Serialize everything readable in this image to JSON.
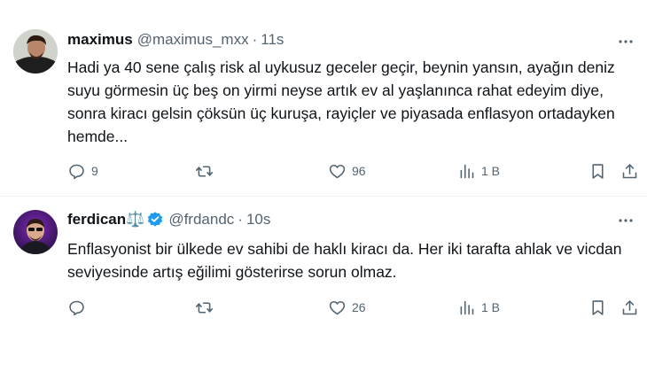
{
  "tweets": [
    {
      "author": "maximus",
      "handle": "@maximus_mxx",
      "separator": "·",
      "time": "11s",
      "text": "Hadi ya 40 sene çalış risk al uykusuz geceler geçir, beynin yansın, ayağın deniz suyu görmesin üç beş on yirmi neyse artık ev al yaşlanınca rahat edeyim diye, sonra kiracı gelsin çöksün üç kuruşa, rayiçler ve piyasada enflasyon ortadayken hemde...",
      "replies": "9",
      "retweets": "",
      "likes": "96",
      "views": "1 B"
    },
    {
      "author": "ferdican⚖️",
      "handle": "@frdandc",
      "separator": "·",
      "time": "10s",
      "verified": true,
      "text": "Enflasyonist bir ülkede ev sahibi de haklı kiracı da. Her iki tarafta ahlak ve vicdan seviyesinde artış eğilimi gösterirse sorun olmaz.",
      "replies": "",
      "retweets": "",
      "likes": "26",
      "views": "1 B"
    }
  ],
  "icons": {
    "reply": "reply-icon",
    "retweet": "retweet-icon",
    "like": "heart-icon",
    "views": "views-icon",
    "bookmark": "bookmark-icon",
    "share": "share-icon",
    "more": "more-icon",
    "verified": "verified-badge-icon"
  },
  "colors": {
    "text": "#0f1419",
    "secondary": "#536471",
    "verified": "#1d9bf0",
    "divider": "#eff3f4"
  }
}
